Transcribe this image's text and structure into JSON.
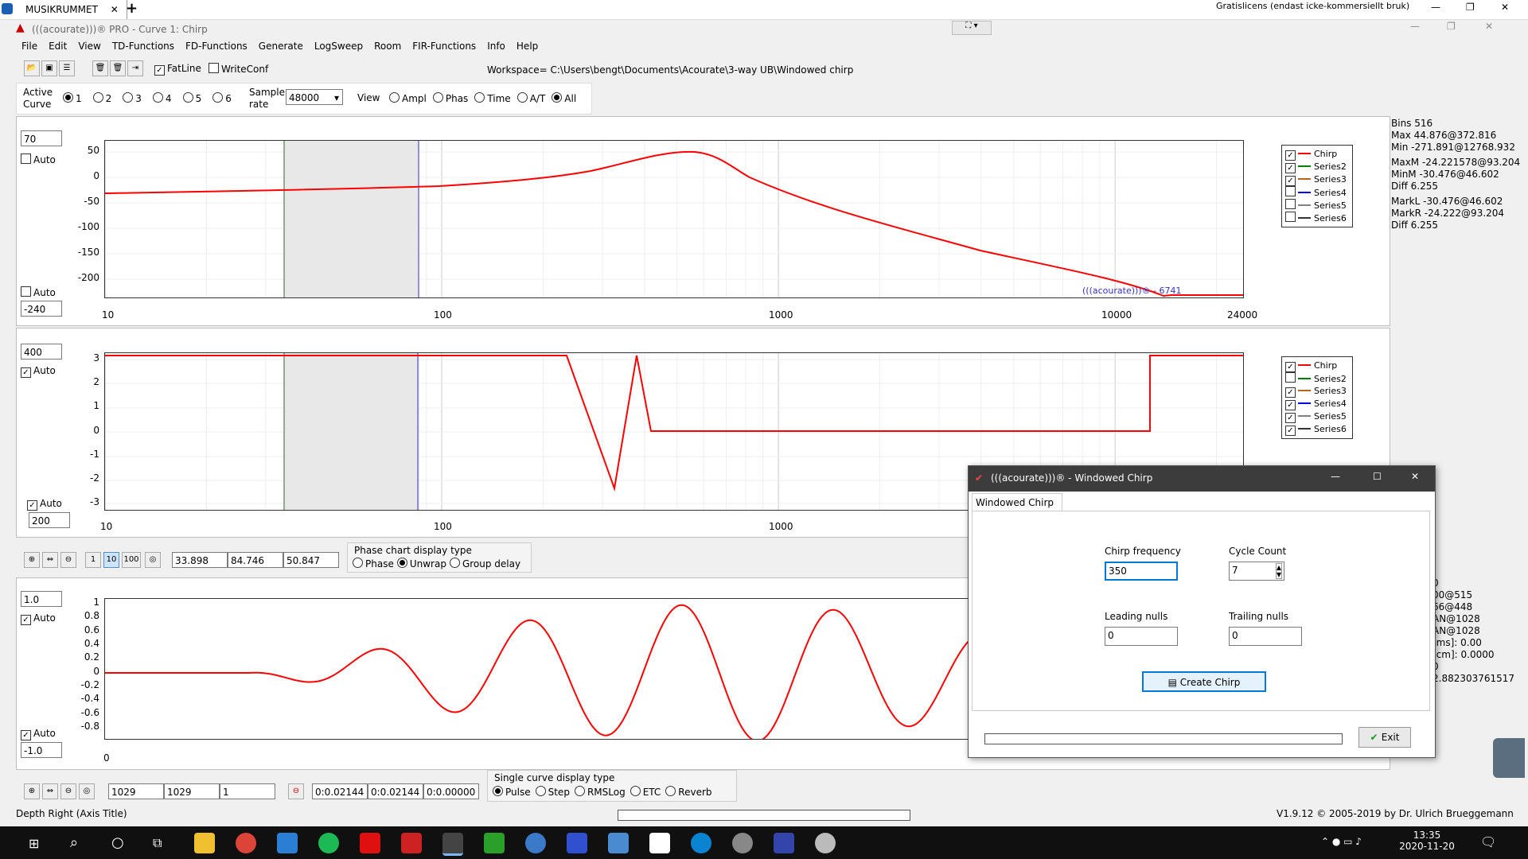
{
  "browser": {
    "tab_label": "MUSIKRUMMET",
    "license_text": "Gratislicens (endast icke-kommersiellt bruk)"
  },
  "app": {
    "title": "(((acourate)))® PRO - Curve 1: Chirp"
  },
  "menu": [
    "File",
    "Edit",
    "View",
    "TD-Functions",
    "FD-Functions",
    "Generate",
    "LogSweep",
    "Room",
    "FIR-Functions",
    "Info",
    "Help"
  ],
  "toolbar": {
    "fatline_label": "FatLine",
    "writeconf_label": "WriteConf",
    "workspace_label": "Workspace=",
    "workspace_path": "C:\\Users\\bengt\\Documents\\Acourate\\3-way UB\\Windowed chirp"
  },
  "active_curve": {
    "label_line1": "Active",
    "label_line2": "Curve",
    "options": [
      "1",
      "2",
      "3",
      "4",
      "5",
      "6"
    ],
    "selected": "1"
  },
  "sample_rate": {
    "label_line1": "Sample",
    "label_line2": "rate",
    "value": "48000"
  },
  "view": {
    "label": "View",
    "options": [
      "Ampl",
      "Phas",
      "Time",
      "A/T",
      "All"
    ],
    "selected": "All"
  },
  "plot1": {
    "top_input": "70",
    "bottom_input": "-240",
    "auto_label": "Auto",
    "yticks": [
      "50",
      "0",
      "-50",
      "-100",
      "-150",
      "-200"
    ],
    "xticks": [
      "10",
      "100",
      "1000",
      "10000",
      "24000"
    ],
    "watermark": "(((acourate)))® - 6741"
  },
  "plot2": {
    "top_input": "400",
    "bottom_input": "200",
    "auto_label": "Auto",
    "yticks": [
      "3",
      "2",
      "1",
      "0",
      "-1",
      "-2",
      "-3"
    ],
    "xticks": [
      "10",
      "100",
      "1000"
    ]
  },
  "plot3": {
    "top_input": "1.0",
    "bottom_input": "-1.0",
    "auto_label": "Auto",
    "yticks": [
      "1",
      "0.8",
      "0.6",
      "0.4",
      "0.2",
      "0",
      "-0.2",
      "-0.4",
      "-0.6",
      "-0.8"
    ],
    "xticks": [
      "0"
    ]
  },
  "legend1": [
    {
      "name": "Chirp",
      "color": "#ff0000",
      "checked": true
    },
    {
      "name": "Series2",
      "color": "#008000",
      "checked": true
    },
    {
      "name": "Series3",
      "color": "#b5651d",
      "checked": true
    },
    {
      "name": "Series4",
      "color": "#0000ff",
      "checked": false
    },
    {
      "name": "Series5",
      "color": "#808080",
      "checked": false
    },
    {
      "name": "Series6",
      "color": "#333333",
      "checked": false
    }
  ],
  "legend2": [
    {
      "name": "Chirp",
      "color": "#ff0000",
      "checked": true
    },
    {
      "name": "Series2",
      "color": "#008000",
      "checked": false
    },
    {
      "name": "Series3",
      "color": "#b5651d",
      "checked": true
    },
    {
      "name": "Series4",
      "color": "#0000ff",
      "checked": true
    },
    {
      "name": "Series5",
      "color": "#808080",
      "checked": true
    },
    {
      "name": "Series6",
      "color": "#333333",
      "checked": true
    }
  ],
  "info": [
    "Bins 516",
    "Max 44.876@372.816",
    "Min -271.891@12768.932",
    "MaxM -24.221578@93.204",
    "MinM -30.476@46.602",
    "Diff 6.255",
    "MarkL -30.476@46.602",
    "MarkR -24.222@93.204",
    "Diff 6.255"
  ],
  "info2": [
    "0",
    "00@515",
    "66@448",
    "AN@1028",
    "AN@1028",
    "[ms]: 0.00",
    "[cm]: 0.0000",
    "0",
    "2.882303761517"
  ],
  "zoom_bar": {
    "btn1": "1",
    "btn10": "10",
    "btn100": "100",
    "f1": "33.898",
    "f2": "84.746",
    "f3": "50.847"
  },
  "phase_group": {
    "title": "Phase chart display type",
    "options": [
      "Phase",
      "Unwrap",
      "Group delay"
    ],
    "selected": "Unwrap"
  },
  "bottom_bar": {
    "f1": "1029",
    "f2": "1029",
    "f3": "1",
    "t1": "0:0.02144",
    "t2": "0:0.02144",
    "t3": "0:0.00000"
  },
  "single_group": {
    "title": "Single curve display type",
    "options": [
      "Pulse",
      "Step",
      "RMSLog",
      "ETC",
      "Reverb"
    ],
    "selected": "Pulse"
  },
  "status": {
    "left": "Depth Right (Axis Title)",
    "right": "V1.9.12 © 2005-2019 by Dr. Ulrich Brueggemann"
  },
  "dialog": {
    "title": "(((acourate)))® - Windowed Chirp",
    "tab": "Windowed Chirp",
    "chirp_freq_label": "Chirp frequency",
    "chirp_freq_value": "350",
    "cycle_label": "Cycle Count",
    "cycle_value": "7",
    "leading_label": "Leading nulls",
    "leading_value": "0",
    "trailing_label": "Trailing nulls",
    "trailing_value": "0",
    "create_label": "Create Chirp",
    "exit_label": "Exit"
  },
  "clock": {
    "time": "13:35",
    "date": "2020-11-20"
  },
  "colors": {
    "curve": "#ff0000",
    "marker_left": "#336633",
    "marker_right": "#3333cc",
    "dialog_accent": "#0078d7"
  }
}
